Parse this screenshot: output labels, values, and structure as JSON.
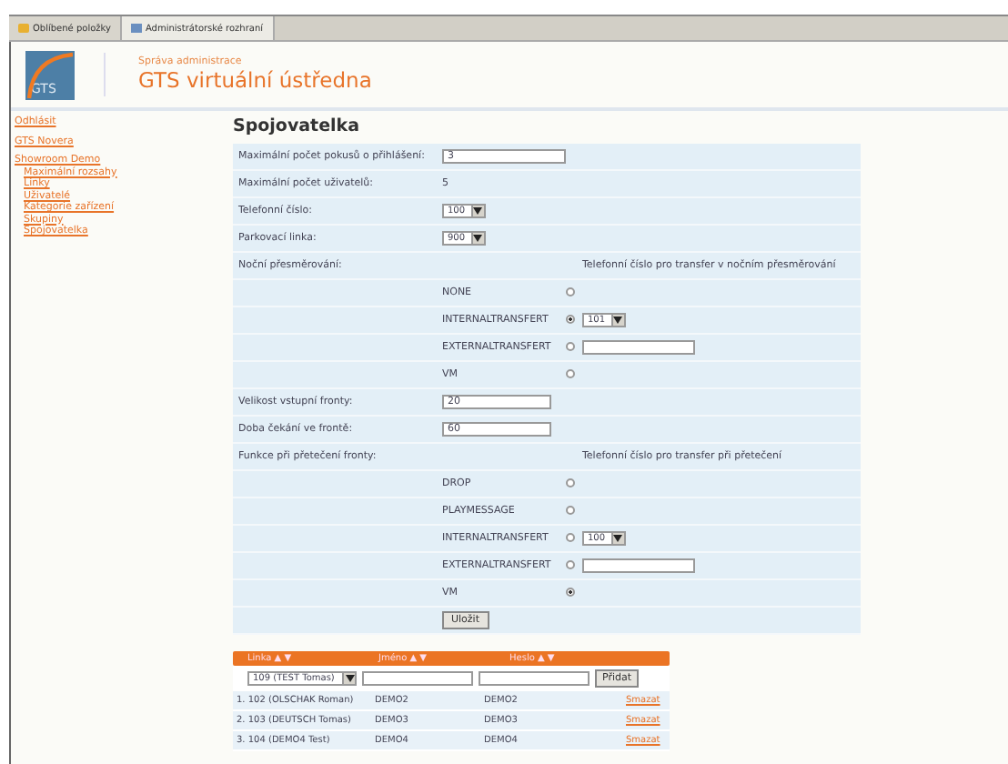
{
  "browser_tabs": [
    {
      "label": "Oblíbené položky",
      "selected": false
    },
    {
      "label": "Administrátorské rozhraní",
      "selected": true
    }
  ],
  "header": {
    "subtitle": "Správa administrace",
    "title": "GTS virtuální ústředna",
    "logo_text": "GTS"
  },
  "sidebar": {
    "items": [
      {
        "label": "Odhlásit"
      },
      {
        "label": "GTS Novera"
      },
      {
        "label": "Showroom Demo",
        "children": [
          {
            "label": "Maximální rozsahy"
          },
          {
            "label": "Linky"
          },
          {
            "label": "Uživatelé"
          },
          {
            "label": "Kategorie zařízení"
          },
          {
            "label": "Skupiny"
          },
          {
            "label": "Spojovatelka"
          }
        ]
      }
    ]
  },
  "page_title": "Spojovatelka",
  "form_rows": [
    {
      "kind": "input",
      "label": "Maximální počet pokusů o přihlášení:",
      "value": "3"
    },
    {
      "kind": "text",
      "label": "Maximální počet uživatelů:",
      "value": "5"
    },
    {
      "kind": "select",
      "label": "Telefonní číslo:",
      "value": "100"
    },
    {
      "kind": "select",
      "label": "Parkovací linka:",
      "value": "900"
    },
    {
      "kind": "heading",
      "label": "Noční přesměrování:",
      "note": "Telefonní číslo pro transfer v nočním přesměrování"
    },
    {
      "kind": "radio",
      "option": "NONE",
      "selected": false
    },
    {
      "kind": "radio",
      "option": "INTERNALTRANSFERT",
      "selected": true,
      "select": "101"
    },
    {
      "kind": "radio",
      "option": "EXTERNALTRANSFERT",
      "selected": false,
      "input": true
    },
    {
      "kind": "radio",
      "option": "VM",
      "selected": false
    },
    {
      "kind": "input",
      "label": "Velikost vstupní fronty:",
      "value": "20"
    },
    {
      "kind": "input",
      "label": "Doba čekání ve frontě:",
      "value": "60"
    },
    {
      "kind": "heading",
      "label": "Funkce při přetečení fronty:",
      "note": "Telefonní číslo pro transfer při přetečení"
    },
    {
      "kind": "radio",
      "option": "DROP",
      "selected": false
    },
    {
      "kind": "radio",
      "option": "PLAYMESSAGE",
      "selected": false
    },
    {
      "kind": "radio",
      "option": "INTERNALTRANSFERT",
      "selected": false,
      "select": "100"
    },
    {
      "kind": "radio",
      "option": "EXTERNALTRANSFERT",
      "selected": false,
      "input": true
    },
    {
      "kind": "radio",
      "option": "VM",
      "selected": true
    },
    {
      "kind": "button",
      "label": "Uložit"
    }
  ],
  "table": {
    "columns": [
      "Linka ▲ ▼",
      "Jméno ▲ ▼",
      "Heslo ▲ ▼"
    ],
    "filter": {
      "select": "109 (TEST Tomas)",
      "button": "Přidat"
    },
    "rows": [
      {
        "linka": "1. 102 (OLSCHAK Roman)",
        "jmeno": "DEMO2",
        "heslo": "DEMO2",
        "action": "Smazat"
      },
      {
        "linka": "2. 103 (DEUTSCH Tomas)",
        "jmeno": "DEMO3",
        "heslo": "DEMO3",
        "action": "Smazat"
      },
      {
        "linka": "3. 104 (DEMO4 Test)",
        "jmeno": "DEMO4",
        "heslo": "DEMO4",
        "action": "Smazat"
      }
    ]
  }
}
